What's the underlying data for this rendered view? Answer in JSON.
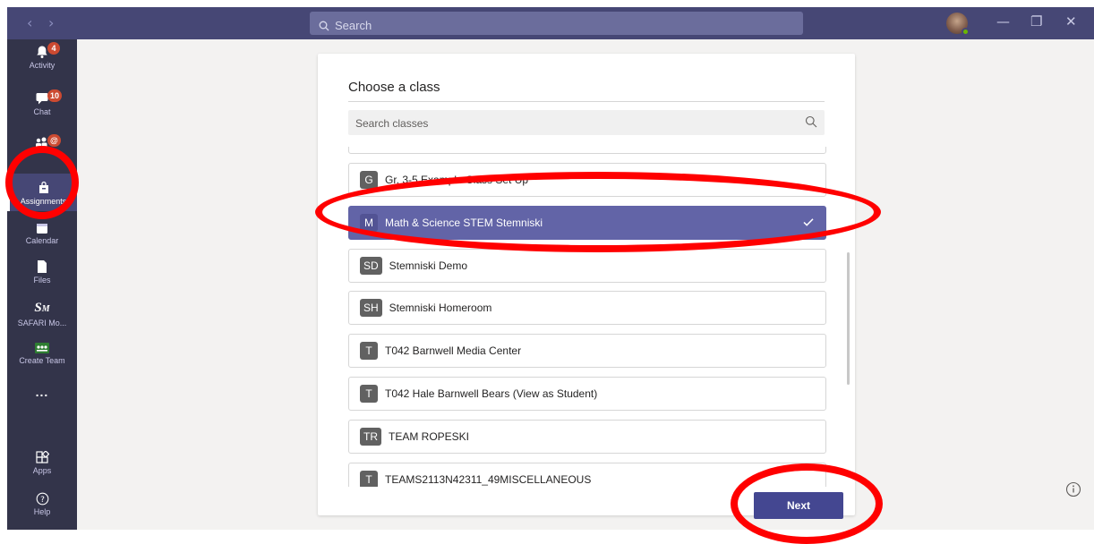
{
  "titlebar": {
    "search_placeholder": "Search",
    "back_glyph": "‹",
    "forward_glyph": "›",
    "window_controls": [
      "—",
      "❐",
      "✕"
    ]
  },
  "rail": {
    "items": [
      {
        "label": "Activity",
        "icon": "bell-icon",
        "badge": "4"
      },
      {
        "label": "Chat",
        "icon": "chat-icon",
        "badge": "10"
      },
      {
        "label": "",
        "icon": "teams-icon",
        "badge": "@"
      },
      {
        "label": "Assignments",
        "icon": "assignments-icon",
        "active": true
      },
      {
        "label": "Calendar",
        "icon": "calendar-icon"
      },
      {
        "label": "Files",
        "icon": "files-icon"
      },
      {
        "label": "SAFARI Mo...",
        "icon": "safari-montage-icon"
      },
      {
        "label": "Create Team",
        "icon": "create-team-icon"
      },
      {
        "label": "...",
        "icon": "more-icon"
      },
      {
        "label": "Apps",
        "icon": "apps-icon"
      },
      {
        "label": "Help",
        "icon": "help-icon"
      }
    ]
  },
  "panel": {
    "title": "Choose a class",
    "search_placeholder": "Search classes",
    "classes": [
      {
        "tile": "G",
        "name": "Gr. 3-5 Example Class Set Up"
      },
      {
        "tile": "M",
        "name": "Math & Science STEM Stemniski",
        "selected": true
      },
      {
        "tile": "SD",
        "name": "Stemniski Demo"
      },
      {
        "tile": "SH",
        "name": "Stemniski Homeroom"
      },
      {
        "tile": "T",
        "name": "T042 Barnwell Media Center"
      },
      {
        "tile": "T",
        "name": "T042 Hale Barnwell Bears (View as Student)"
      },
      {
        "tile": "TR",
        "name": "TEAM ROPESKI"
      },
      {
        "tile": "T",
        "name": "TEAMS2113N42311_49MISCELLANEOUS"
      }
    ],
    "next_label": "Next"
  },
  "colors": {
    "titlebar": "#464775",
    "rail": "#33344a",
    "selected_row": "#6264a7",
    "next_button": "#444791",
    "annotation": "#ff0000"
  }
}
